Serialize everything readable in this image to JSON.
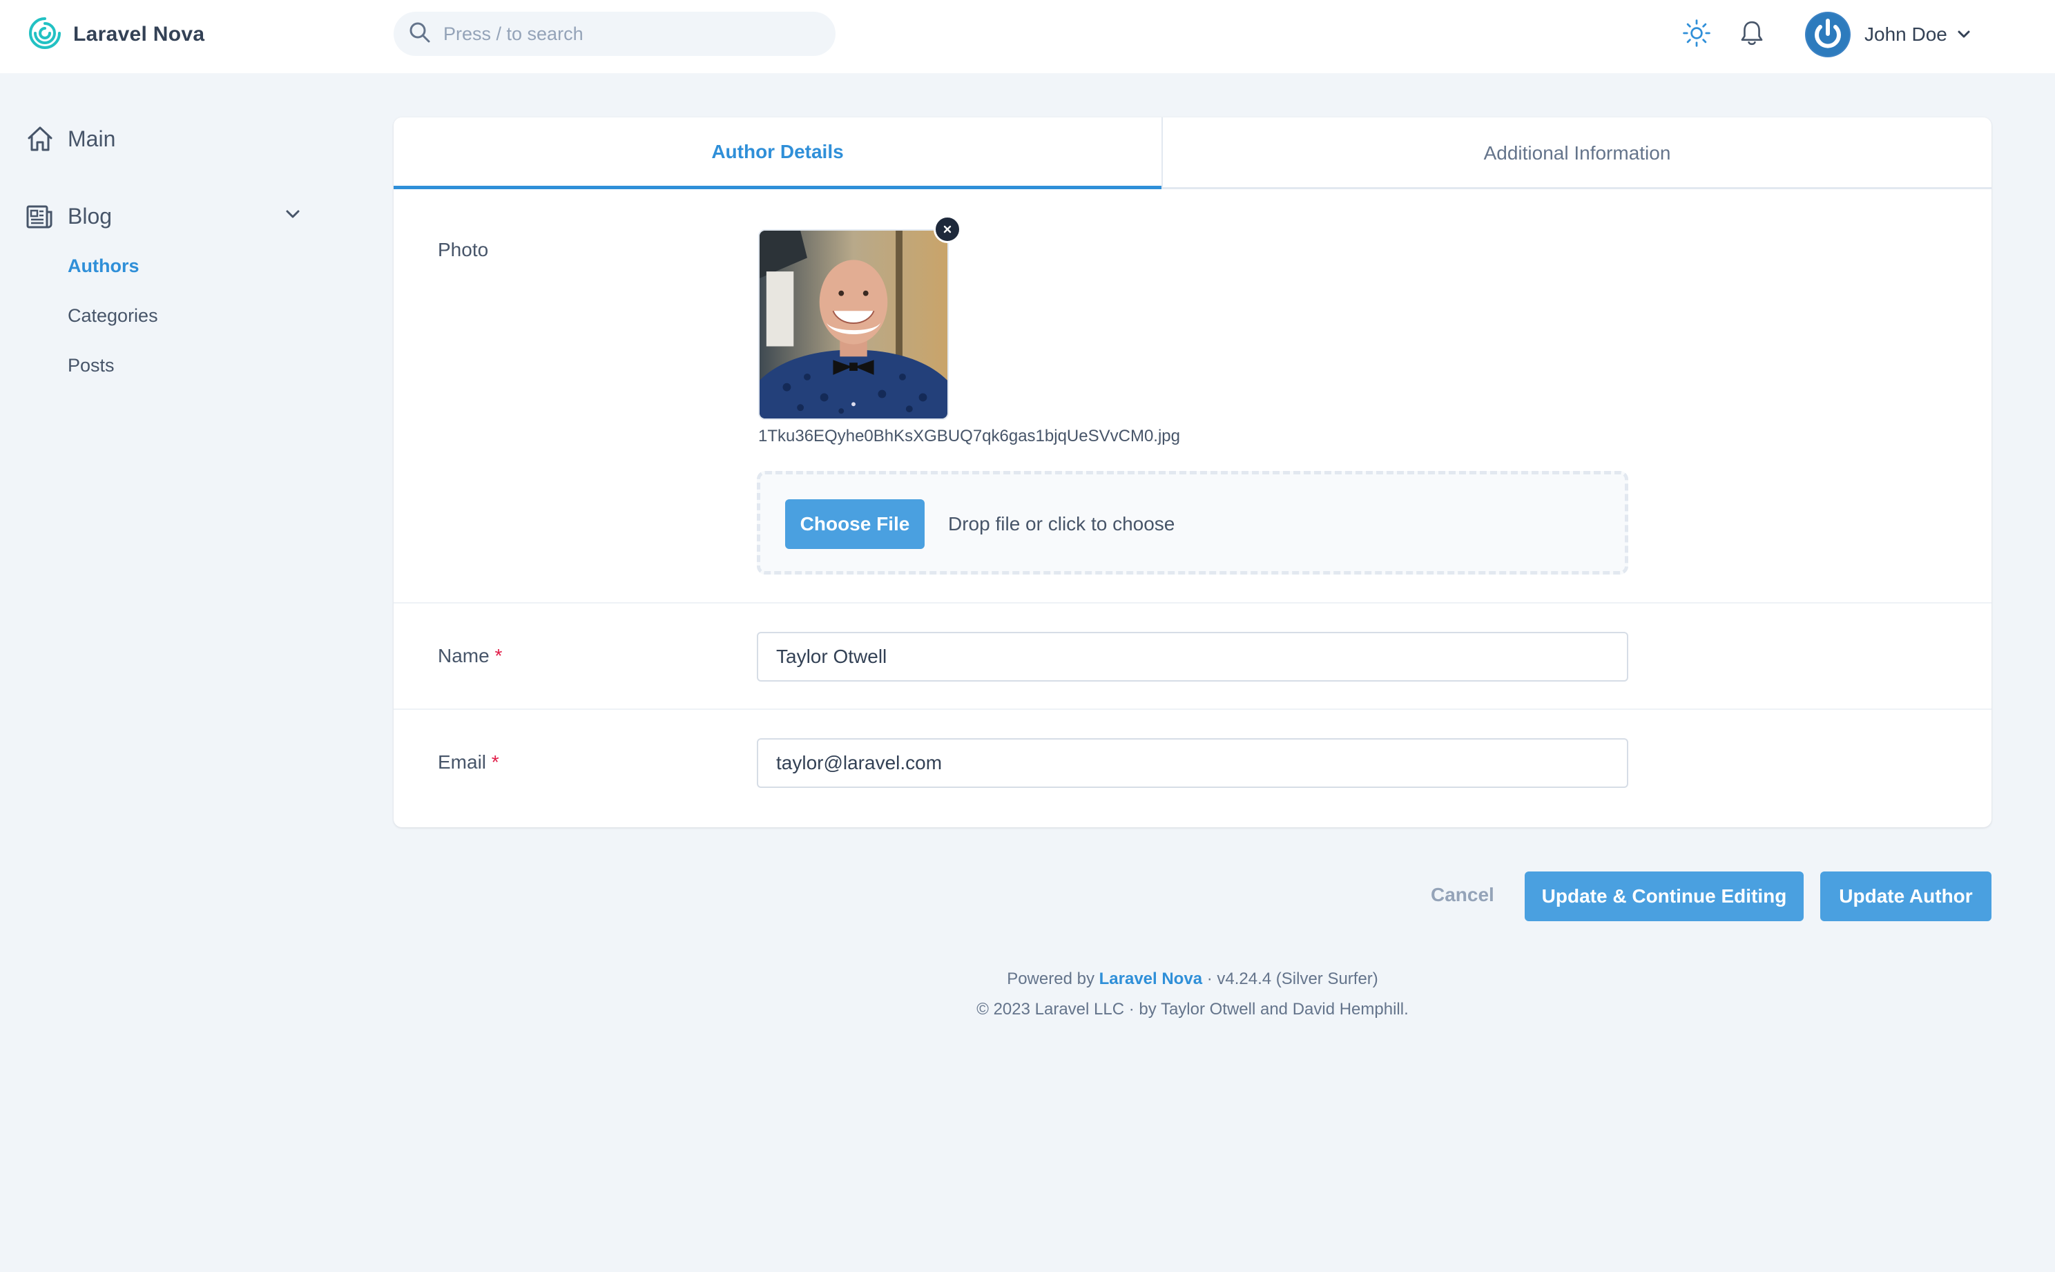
{
  "brand": {
    "name": "Laravel Nova"
  },
  "search": {
    "placeholder": "Press / to search"
  },
  "user": {
    "name": "John Doe"
  },
  "sidebar": {
    "main_label": "Main",
    "blog_label": "Blog",
    "items": [
      {
        "label": "Authors",
        "active": true
      },
      {
        "label": "Categories",
        "active": false
      },
      {
        "label": "Posts",
        "active": false
      }
    ]
  },
  "tabs": [
    {
      "label": "Author Details",
      "active": true
    },
    {
      "label": "Additional Information",
      "active": false
    }
  ],
  "form": {
    "photo_label": "Photo",
    "photo_filename": "1Tku36EQyhe0BhKsXGBUQ7qk6gas1bjqUeSVvCM0.jpg",
    "choose_file_label": "Choose File",
    "drop_text": "Drop file or click to choose",
    "name_label": "Name",
    "name_value": "Taylor Otwell",
    "email_label": "Email",
    "email_value": "taylor@laravel.com",
    "required_marker": "*"
  },
  "actions": {
    "cancel": "Cancel",
    "update_continue": "Update & Continue Editing",
    "update": "Update Author"
  },
  "footer": {
    "powered_prefix": "Powered by",
    "powered_link": "Laravel Nova",
    "version": "· v4.24.4 (Silver Surfer)",
    "copyright": "© 2023 Laravel LLC · by Taylor Otwell and David Hemphill."
  },
  "colors": {
    "accent": "#4aa0e0",
    "link": "#2f8fd8",
    "background": "#f1f5f9",
    "required": "#e11d48"
  },
  "icons": [
    "nova-logo-icon",
    "search-icon",
    "sun-icon",
    "bell-icon",
    "power-icon",
    "chevron-down-icon",
    "home-icon",
    "newspaper-icon",
    "close-icon"
  ]
}
